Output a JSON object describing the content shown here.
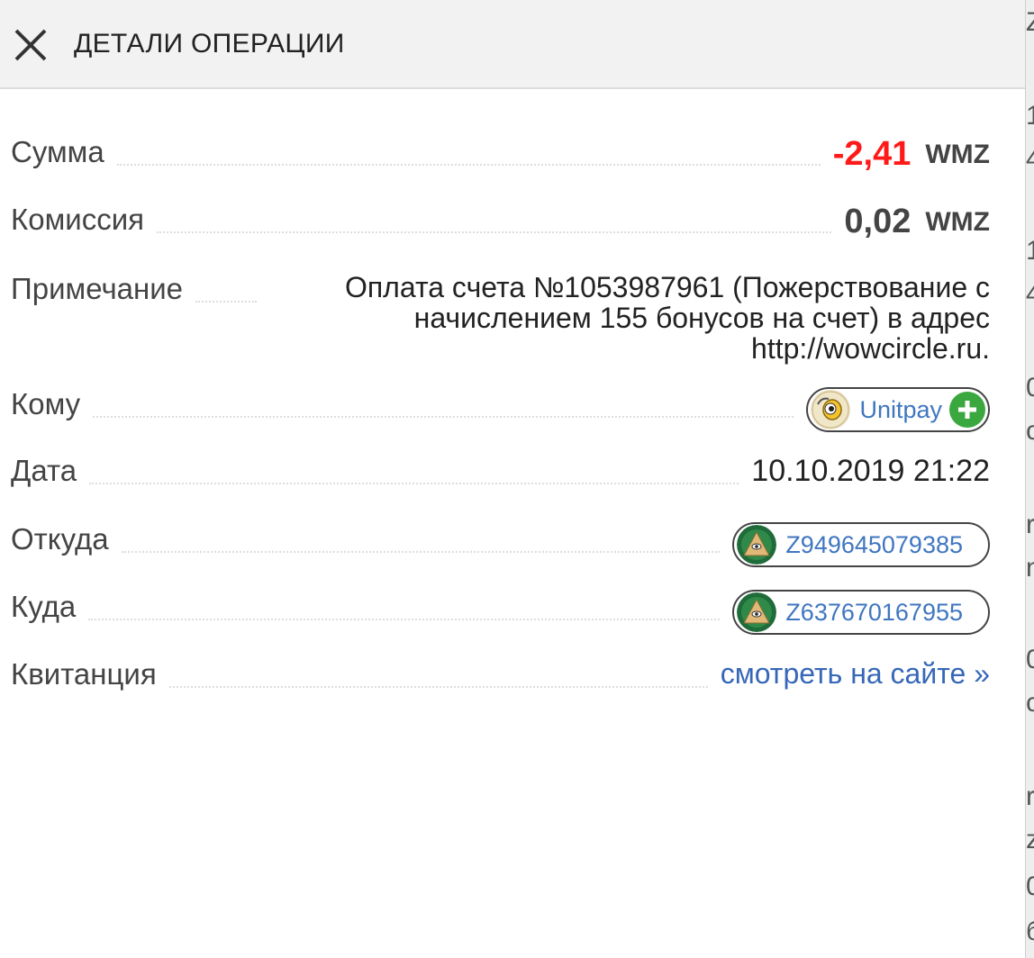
{
  "header": {
    "title": "ДЕТАЛИ ОПЕРАЦИИ",
    "close_icon": "close-icon"
  },
  "details": {
    "amount": {
      "label": "Сумма",
      "value": "-2,41",
      "currency": "WMZ",
      "color": "#ff1a1a"
    },
    "fee": {
      "label": "Комиссия",
      "value": "0,02",
      "currency": "WMZ"
    },
    "note": {
      "label": "Примечание",
      "value": "Оплата счета №1053987961 (Пожерствование с начислением 155 бонусов на счет) в адрес http://wowcircle.ru."
    },
    "to_whom": {
      "label": "Кому",
      "name": "Unitpay",
      "avatar_icon": "unitpay-avatar-icon",
      "action_icon": "plus-icon"
    },
    "date": {
      "label": "Дата",
      "value": "10.10.2019 21:22"
    },
    "from": {
      "label": "Откуда",
      "purse": "Z949645079385",
      "icon": "webmoney-purse-icon"
    },
    "to": {
      "label": "Куда",
      "purse": "Z637670167955",
      "icon": "webmoney-purse-icon"
    },
    "receipt": {
      "label": "Квитанция",
      "link": "смотреть на сайте »"
    }
  },
  "colors": {
    "link": "#3667b8",
    "negative": "#ff1a1a",
    "header_bg": "#f2f2f2",
    "plus": "#3aa83f"
  },
  "background_edge": [
    "Z",
    "1",
    "4",
    "1",
    "4",
    "0",
    "c",
    "r",
    "n",
    "0",
    "c",
    "r",
    "z",
    "0",
    "б"
  ]
}
